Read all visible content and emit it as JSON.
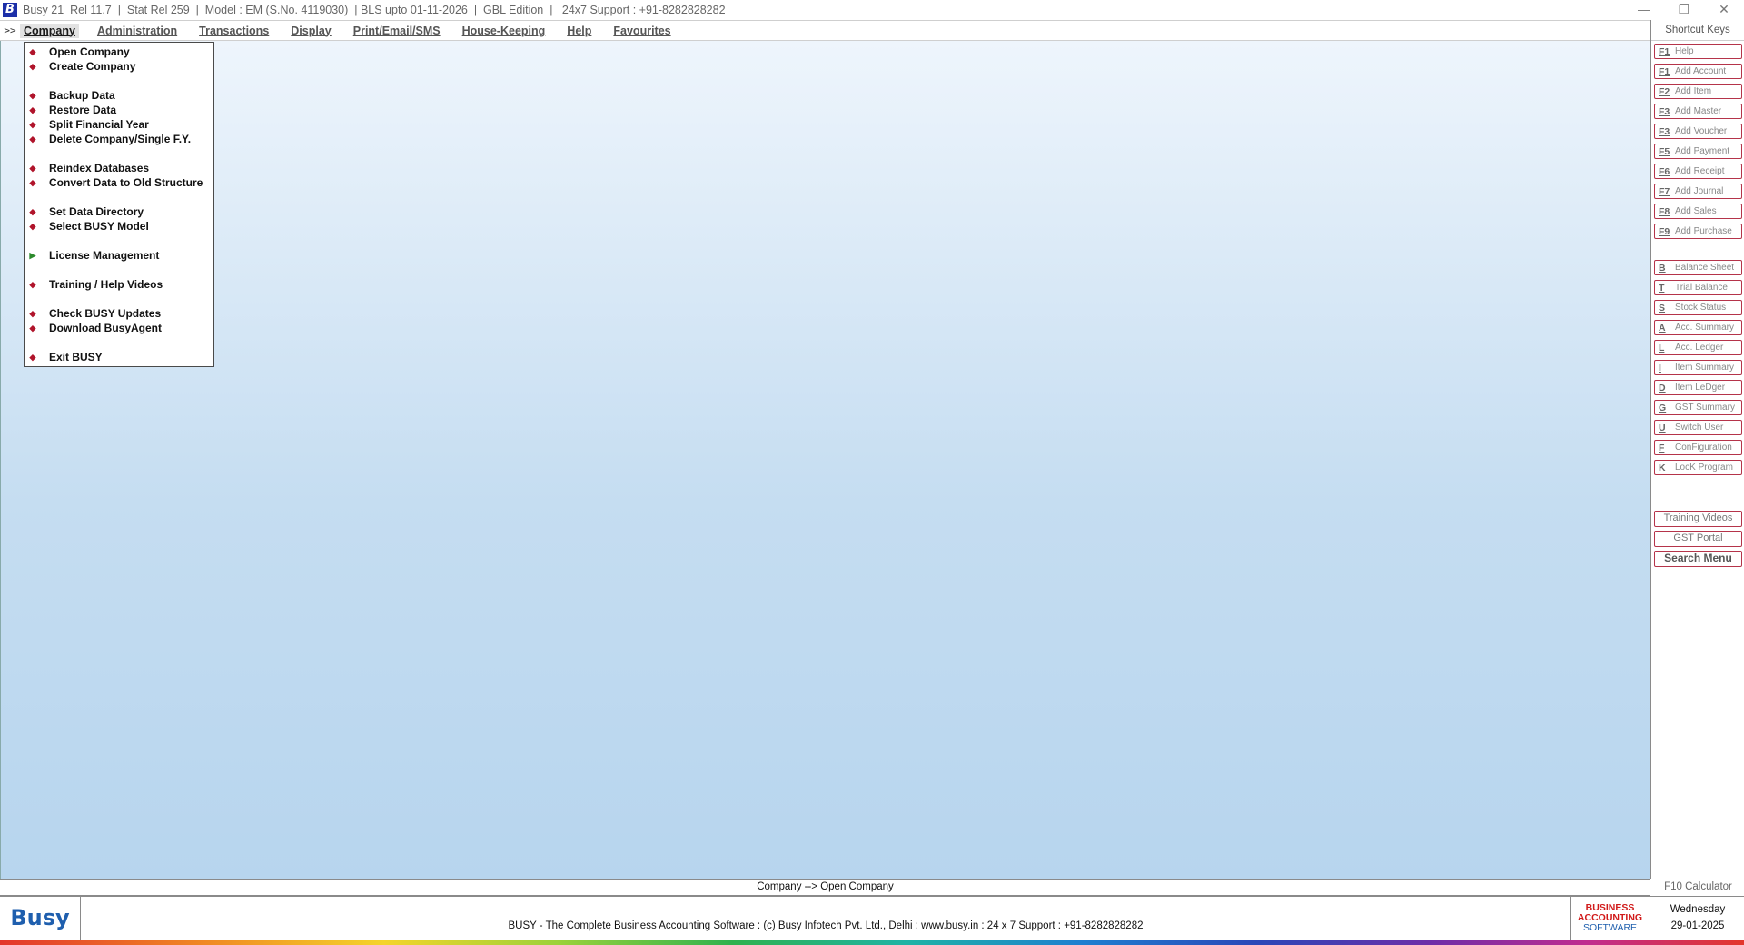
{
  "titlebar": {
    "title": "Busy 21  Rel 11.7  |  Stat Rel 259  |  Model : EM (S.No. 4119030)  | BLS upto 01-11-2026  |  GBL Edition  |   24x7 Support : +91-8282828282",
    "minimize": "—",
    "restore": "❐",
    "close": "✕"
  },
  "menubar": {
    "chevron": ">>",
    "items": [
      "Company",
      "Administration",
      "Transactions",
      "Display",
      "Print/Email/SMS",
      "House-Keeping",
      "Help",
      "Favourites"
    ],
    "active": "Company"
  },
  "company_menu": {
    "groups": [
      [
        "Open Company",
        "Create Company"
      ],
      [
        "Backup Data",
        "Restore Data",
        "Split Financial Year",
        "Delete Company/Single F.Y."
      ],
      [
        "Reindex Databases",
        "Convert Data to Old Structure"
      ],
      [
        "Set Data Directory",
        "Select BUSY Model"
      ],
      [
        "License Management"
      ],
      [
        "Training / Help Videos"
      ],
      [
        "Check BUSY Updates",
        "Download BusyAgent"
      ],
      [
        "Exit BUSY"
      ]
    ]
  },
  "shortcuts": {
    "header": "Shortcut Keys",
    "keys": [
      {
        "key": "F1",
        "label": "Help"
      },
      {
        "key": "F1",
        "label": "Add Account"
      },
      {
        "key": "F2",
        "label": "Add Item"
      },
      {
        "key": "F3",
        "label": "Add Master"
      },
      {
        "key": "F3",
        "label": "Add Voucher"
      },
      {
        "key": "F5",
        "label": "Add Payment"
      },
      {
        "key": "F6",
        "label": "Add Receipt"
      },
      {
        "key": "F7",
        "label": "Add Journal"
      },
      {
        "key": "F8",
        "label": "Add Sales"
      },
      {
        "key": "F9",
        "label": "Add Purchase"
      }
    ],
    "reports": [
      {
        "key": "B",
        "label": "Balance Sheet"
      },
      {
        "key": "T",
        "label": "Trial Balance"
      },
      {
        "key": "S",
        "label": "Stock Status"
      },
      {
        "key": "A",
        "label": "Acc. Summary"
      },
      {
        "key": "L",
        "label": "Acc. Ledger"
      },
      {
        "key": "I",
        "label": "Item Summary"
      },
      {
        "key": "D",
        "label": "Item LeDger"
      },
      {
        "key": "G",
        "label": "GST Summary"
      },
      {
        "key": "U",
        "label": "Switch User"
      },
      {
        "key": "F",
        "label": "ConFiguration"
      },
      {
        "key": "K",
        "label": "LocK Program"
      }
    ],
    "buttons": {
      "training": "Training Videos",
      "gst": "GST Portal",
      "search": "Search Menu"
    },
    "calculator": "F10 Calculator"
  },
  "status_line": "Company --> Open Company",
  "footer": {
    "logo": "Busy",
    "text": "BUSY - The Complete Business Accounting Software  :  (c) Busy Infotech Pvt. Ltd., Delhi  :  www.busy.in  :  24 x 7 Support : +91-8282828282",
    "brand_line1": "BUSINESS",
    "brand_line2": "ACCOUNTING",
    "brand_line3": "SOFTWARE",
    "day": "Wednesday",
    "date": "29-01-2025"
  },
  "colors": {
    "accent_border": "#b5344a",
    "bullet": "#b0142b",
    "arrow_bullet": "#2c8a2c",
    "brand_blue": "#1f5fae",
    "brand_red": "#d11a1a"
  },
  "icons": {
    "bullet": "bullet-icon",
    "submenu_arrow": "submenu-arrow-icon"
  }
}
